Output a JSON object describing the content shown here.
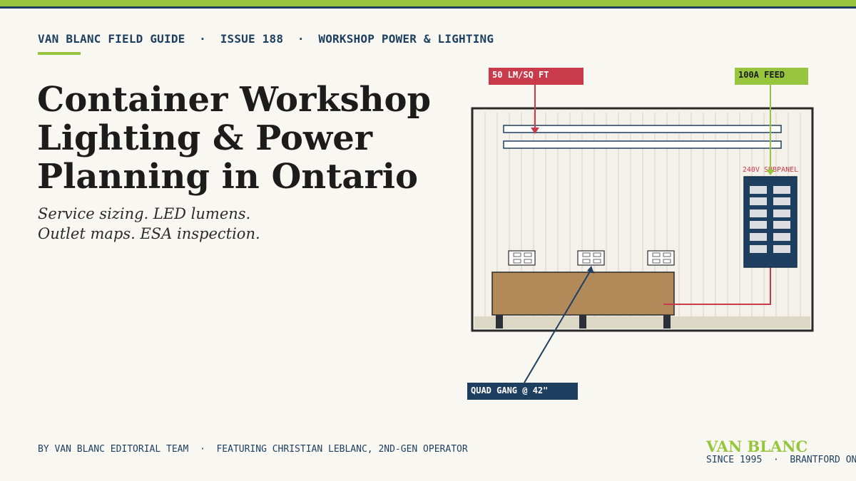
{
  "colors": {
    "accent_green": "#98c53e",
    "navy": "#1e3f5f",
    "red": "#c93a4a",
    "background": "#f8f7f2",
    "bench_wood": "#b28a5a"
  },
  "header": {
    "publication": "VAN BLANC FIELD GUIDE",
    "separator": "·",
    "issue": "ISSUE 188",
    "section": "WORKSHOP POWER & LIGHTING"
  },
  "headline": {
    "line1": "Container Workshop",
    "line2": "Lighting & Power",
    "line3": "Planning in Ontario"
  },
  "subhead": {
    "line1": "Service sizing. LED lumens.",
    "line2": "Outlet maps. ESA inspection."
  },
  "diagram": {
    "callout_lumens": "50 LM/SQ FT",
    "callout_feed": "100A FEED",
    "subpanel_label": "240V SUBPANEL",
    "callout_outlet": "QUAD GANG @ 42\""
  },
  "footer": {
    "byline": "BY VAN BLANC EDITORIAL TEAM",
    "separator": "·",
    "featuring": "FEATURING CHRISTIAN LEBLANC, 2ND-GEN OPERATOR",
    "brand": "VAN BLANC",
    "since": "SINCE 1995",
    "location": "BRANTFORD ON"
  }
}
